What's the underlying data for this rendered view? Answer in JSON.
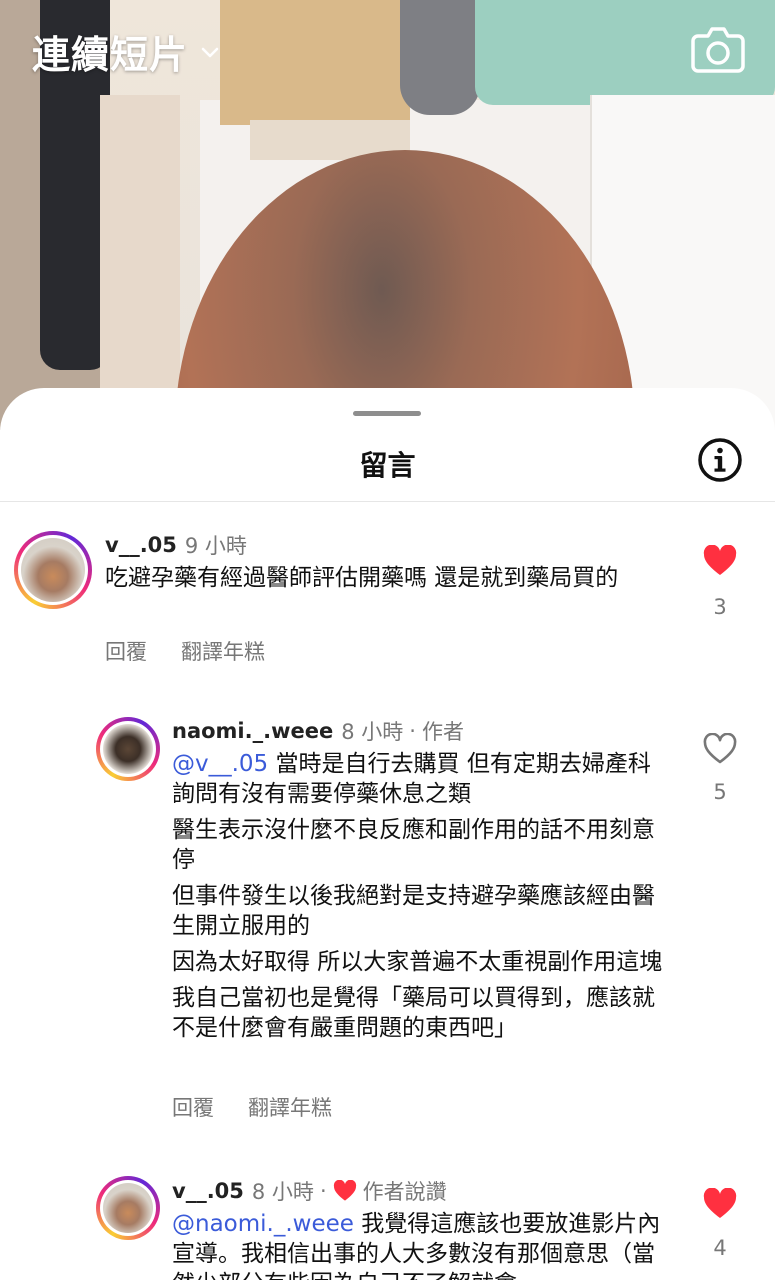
{
  "header": {
    "title": "連續短片",
    "dropdown_icon": "chevron-down-icon",
    "camera_icon": "camera-icon"
  },
  "sheet": {
    "title": "留言",
    "info_icon": "info-icon"
  },
  "comments": [
    {
      "username": "v__.05",
      "time": "9 小時",
      "text": "吃避孕藥有經過醫師評估開藥嗎 還是就到藥局買的",
      "reply_label": "回覆",
      "translate_label": "翻譯年糕",
      "likes": "3",
      "liked": true
    },
    {
      "username": "naomi._.weee",
      "time": "8 小時",
      "author_label": "作者",
      "mention": "@v__.05",
      "paragraphs": [
        "當時是自行去購買 但有定期去婦產科詢問有沒有需要停藥休息之類",
        "醫生表示沒什麼不良反應和副作用的話不用刻意停",
        "但事件發生以後我絕對是支持避孕藥應該經由醫生開立服用的",
        "因為太好取得 所以大家普遍不太重視副作用這塊",
        "我自己當初也是覺得「藥局可以買得到，應該就不是什麼會有嚴重問題的東西吧」"
      ],
      "reply_label": "回覆",
      "translate_label": "翻譯年糕",
      "likes": "5",
      "liked": false
    },
    {
      "username": "v__.05",
      "time": "8 小時",
      "author_liked_label": "作者說讚",
      "mention": "@naomi._.weee",
      "text": "我覺得這應該也要放進影片內宣導。我相信出事的人大多數沒有那個意思（當然少部分有些因為自己不了解就會",
      "likes": "4",
      "liked": true
    }
  ],
  "colors": {
    "like_red": "#ff3040",
    "mention_blue": "#3b5bd9",
    "muted_text": "#777777"
  }
}
